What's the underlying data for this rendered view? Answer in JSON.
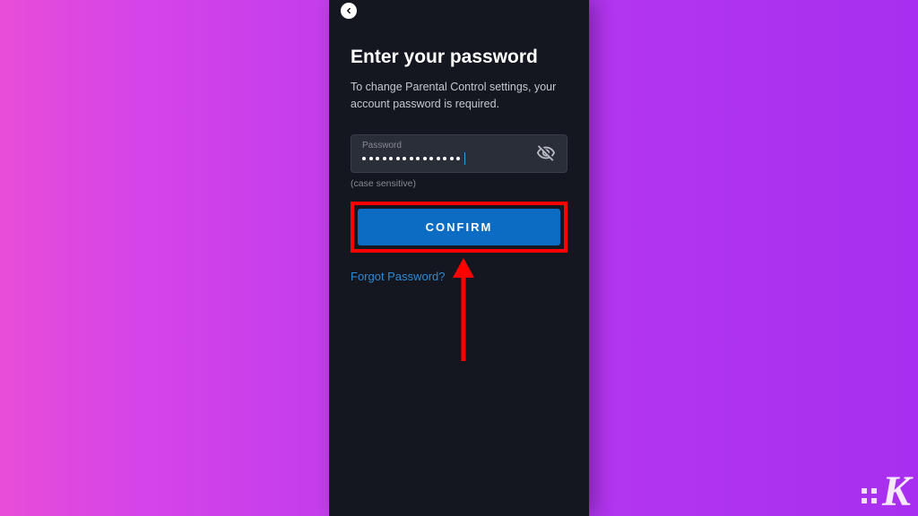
{
  "screen": {
    "title": "Enter your password",
    "subtitle": "To change Parental Control settings, your account password is required.",
    "input": {
      "label": "Password",
      "masked_length": 15,
      "helper": "(case sensitive)"
    },
    "confirm_button": "CONFIRM",
    "forgot_link": "Forgot Password?"
  }
}
